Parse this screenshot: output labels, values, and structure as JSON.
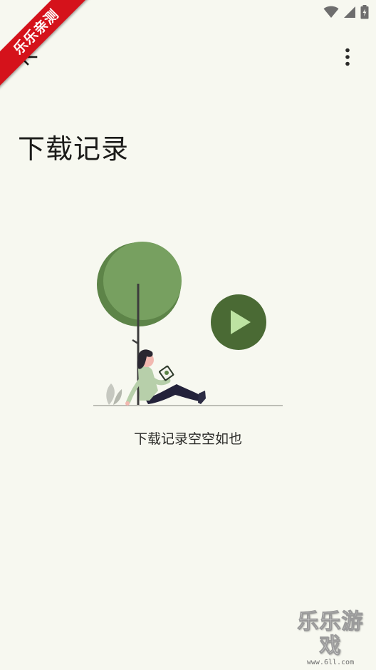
{
  "ribbon": {
    "label": "乐乐亲测"
  },
  "status_bar": {
    "icons": [
      "wifi-icon",
      "cellular-signal-icon",
      "battery-charging-icon"
    ]
  },
  "toolbar": {
    "back_icon": "arrow-back-icon",
    "more_icon": "more-vertical-icon"
  },
  "page": {
    "title": "下载记录",
    "empty_message": "下载记录空空如也"
  },
  "illustration": {
    "description_icon": "person-reading-under-tree-illustration",
    "colors": {
      "tree_light": "#77a060",
      "tree_dark": "#5d8448",
      "play_circle": "#4a6a34",
      "play_triangle": "#bde3a2",
      "shirt": "#b7cfaa",
      "pants": "#23223a",
      "hair": "#2a2731"
    }
  },
  "watermark": {
    "main": "乐乐游戏",
    "url": "www.6ll.com"
  },
  "colors": {
    "background": "#f7f8f0",
    "text_primary": "#1b1b19",
    "ribbon": "#d5121b"
  }
}
